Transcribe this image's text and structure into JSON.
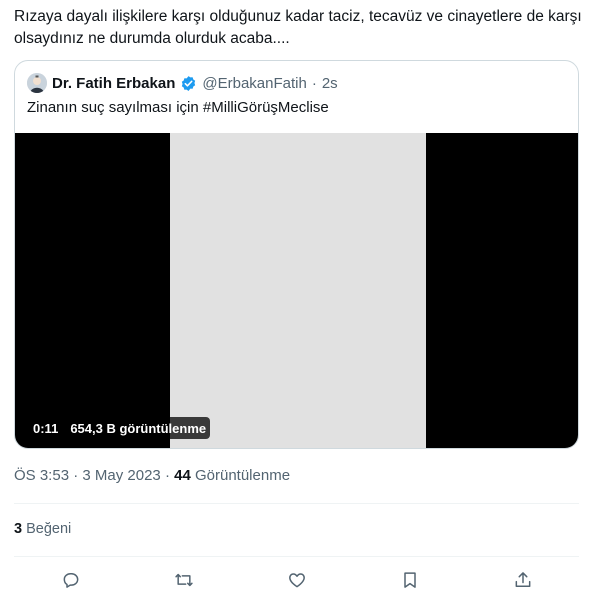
{
  "tweet": {
    "text": "Rızaya dayalı ilişkilere karşı olduğunuz kadar taciz, tecavüz ve cinayetlere de karşı olsaydınız ne durumda olurduk acaba...."
  },
  "quoted_tweet": {
    "author_name": "Dr. Fatih Erbakan",
    "handle": "@ErbakanFatih",
    "separator": "·",
    "time": "2s",
    "text": "Zinanın suç sayılması için #MilliGörüşMeclise",
    "media": {
      "duration": "0:11",
      "views": "654,3 B görüntülenme"
    }
  },
  "meta": {
    "time": "ÖS 3:53",
    "separator": "·",
    "date": "3 May 2023",
    "separator2": "·",
    "views_count": "44",
    "views_label": "Görüntülenme"
  },
  "engagement": {
    "likes_count": "3",
    "likes_label": "Beğeni"
  },
  "colors": {
    "text": "#0f1419",
    "secondary": "#536471",
    "border": "#cfd9de",
    "verified": "#1d9bf0"
  }
}
